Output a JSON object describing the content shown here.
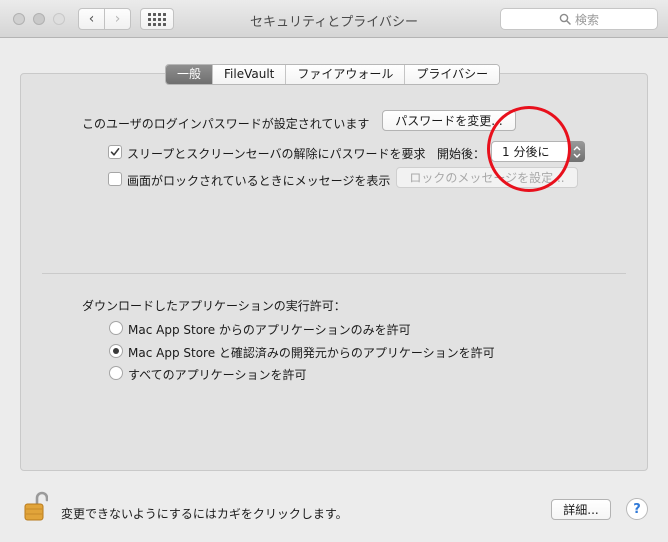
{
  "window": {
    "title": "セキュリティとプライバシー",
    "search_placeholder": "検索"
  },
  "nav": {
    "back_glyph": "‹",
    "forward_glyph": "›"
  },
  "tabs": [
    {
      "label": "一般",
      "active": true
    },
    {
      "label": "FileVault",
      "active": false
    },
    {
      "label": "ファイアウォール",
      "active": false
    },
    {
      "label": "プライバシー",
      "active": false
    }
  ],
  "general": {
    "login_password_text": "このユーザのログインパスワードが設定されています",
    "change_password_button": "パスワードを変更...",
    "require_password": {
      "checked": true,
      "label": "スリープとスクリーンセーバの解除にパスワードを要求",
      "delay_label": "開始後：",
      "delay_value": "1 分後に"
    },
    "lock_message": {
      "checked": false,
      "label": "画面がロックされているときにメッセージを表示",
      "button": "ロックのメッセージを設定..."
    }
  },
  "downloads": {
    "heading": "ダウンロードしたアプリケーションの実行許可：",
    "options": [
      {
        "label": "Mac App Store からのアプリケーションのみを許可",
        "selected": false
      },
      {
        "label": "Mac App Store と確認済みの開発元からのアプリケーションを許可",
        "selected": true
      },
      {
        "label": "すべてのアプリケーションを許可",
        "selected": false
      }
    ]
  },
  "footer": {
    "lock_text": "変更できないようにするにはカギをクリックします。",
    "advanced_button": "詳細...",
    "help_glyph": "?"
  },
  "colors": {
    "annotation": "#e8101c",
    "lock_gold": "#e1a43a"
  }
}
